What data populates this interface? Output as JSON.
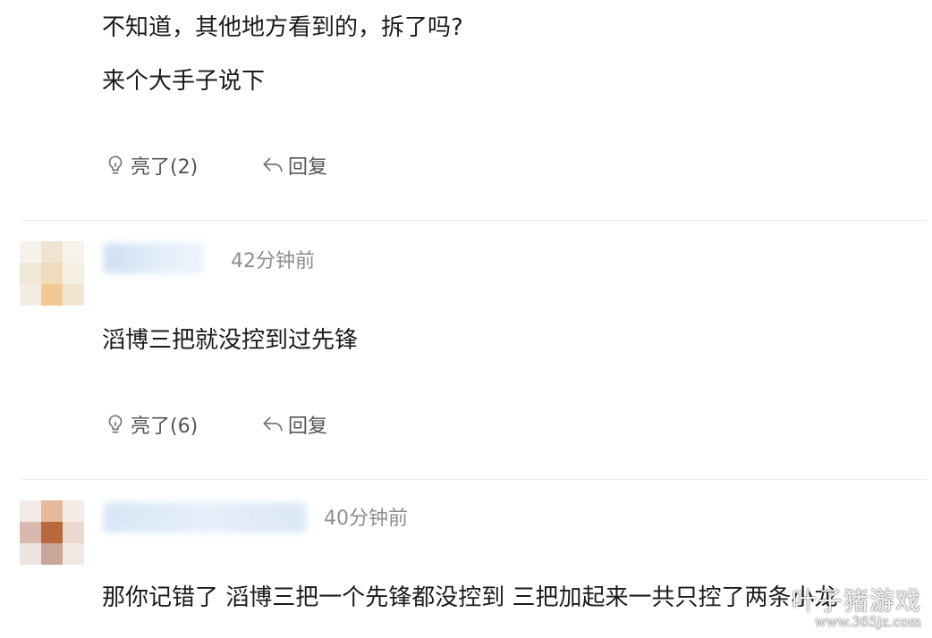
{
  "comments": [
    {
      "lines": [
        "不知道，其他地方看到的，拆了吗?",
        "来个大手子说下"
      ],
      "like_label": "亮了(2)",
      "reply_label": "回复"
    },
    {
      "timestamp": "42分钟前",
      "lines": [
        "滔博三把就没控到过先锋"
      ],
      "like_label": "亮了(6)",
      "reply_label": "回复"
    },
    {
      "timestamp": "40分钟前",
      "lines": [
        "那你记错了 滔博三把一个先锋都没控到 三把加起来一共只控了两条小龙"
      ]
    }
  ],
  "watermark": {
    "name": "叶子猪游戏",
    "url": "www.365jz.com"
  },
  "icons": {
    "like": "lightbulb-icon",
    "reply": "reply-arrow-icon"
  },
  "colors": {
    "text": "#1b1b1b",
    "meta": "#8e8e8e",
    "action": "#555555",
    "divider": "#e8e8e8"
  }
}
